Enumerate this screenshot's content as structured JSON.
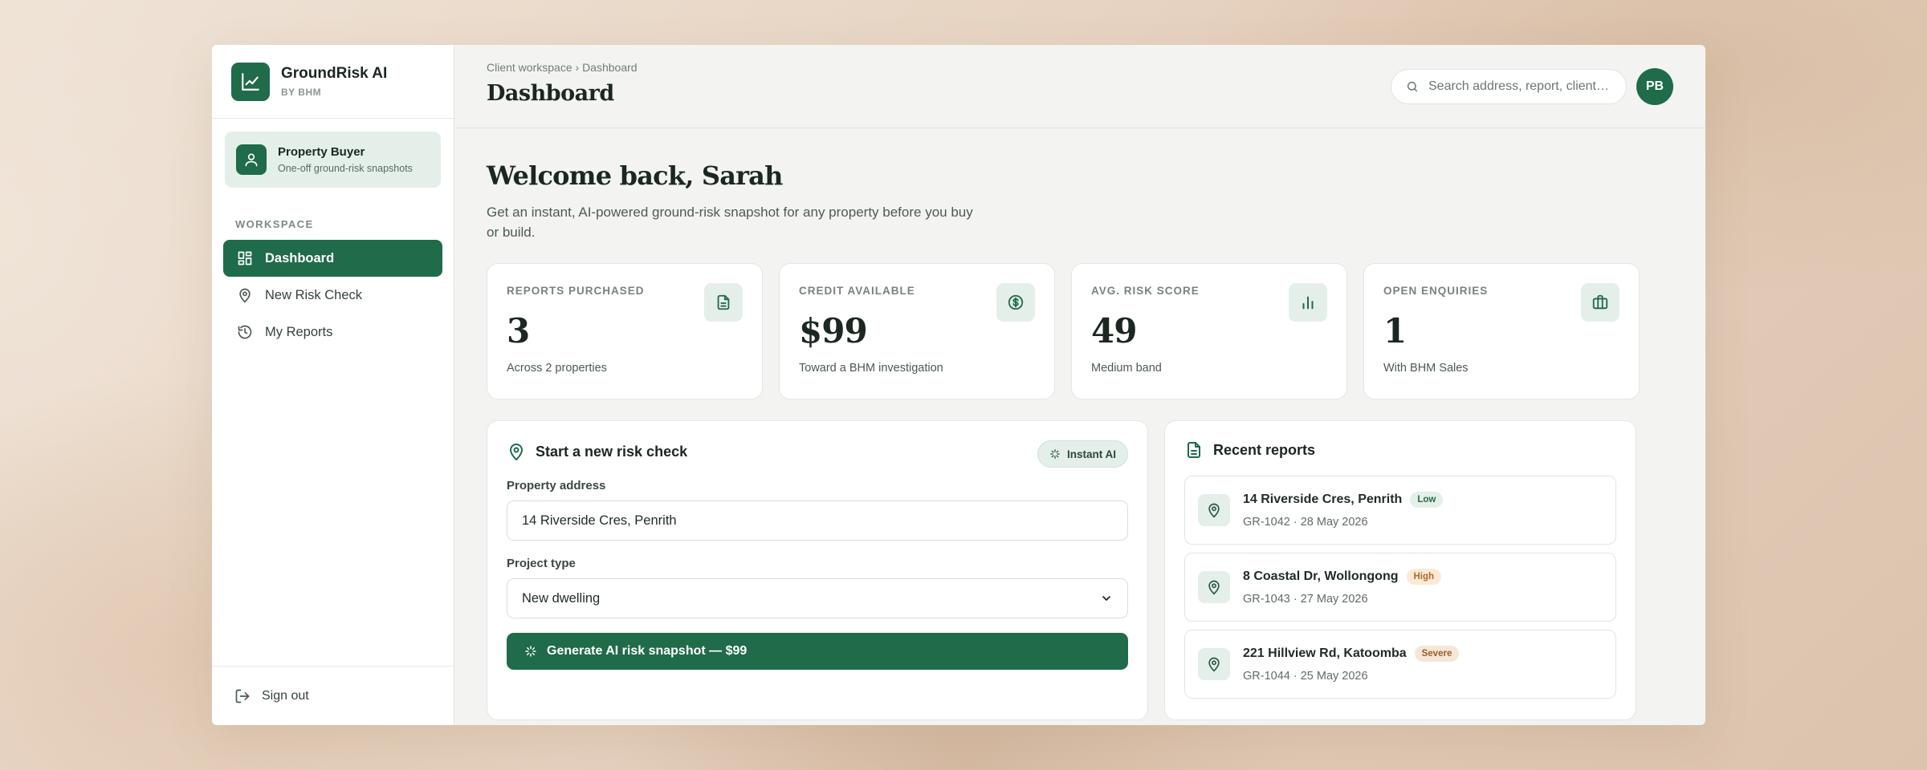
{
  "brand": {
    "name": "GroundRisk AI",
    "sub": "BY BHM"
  },
  "role": {
    "title": "Property Buyer",
    "subtitle": "One-off ground-risk snapshots"
  },
  "sidebar": {
    "section_label": "WORKSPACE",
    "items": [
      {
        "label": "Dashboard",
        "icon": "dashboard-icon",
        "active": true
      },
      {
        "label": "New Risk Check",
        "icon": "map-pin-icon",
        "active": false
      },
      {
        "label": "My Reports",
        "icon": "history-icon",
        "active": false
      }
    ],
    "sign_out": "Sign out"
  },
  "header": {
    "breadcrumb_root": "Client workspace",
    "breadcrumb_sep": "›",
    "breadcrumb_current": "Dashboard",
    "title": "Dashboard",
    "search_placeholder": "Search address, report, client…",
    "avatar_initials": "PB"
  },
  "welcome": {
    "heading": "Welcome back, Sarah",
    "intro": "Get an instant, AI-powered ground-risk snapshot for any property before you buy or build."
  },
  "stats": [
    {
      "label": "REPORTS PURCHASED",
      "value": "3",
      "sub": "Across 2 properties",
      "icon": "document-icon"
    },
    {
      "label": "CREDIT AVAILABLE",
      "value": "$99",
      "sub": "Toward a BHM investigation",
      "icon": "dollar-icon"
    },
    {
      "label": "AVG. RISK SCORE",
      "value": "49",
      "sub": "Medium band",
      "icon": "bar-chart-icon"
    },
    {
      "label": "OPEN ENQUIRIES",
      "value": "1",
      "sub": "With BHM Sales",
      "icon": "briefcase-icon"
    }
  ],
  "risk_check": {
    "title": "Start a new risk check",
    "badge": "Instant AI",
    "address_label": "Property address",
    "address_value": "14 Riverside Cres, Penrith",
    "project_label": "Project type",
    "project_value": "New dwelling",
    "cta": "Generate AI risk snapshot — $99"
  },
  "recent": {
    "title": "Recent reports",
    "items": [
      {
        "address": "14 Riverside Cres, Penrith",
        "risk": "Low",
        "level": "low",
        "meta": "GR-1042 · 28 May 2026"
      },
      {
        "address": "8 Coastal Dr, Wollongong",
        "risk": "High",
        "level": "high",
        "meta": "GR-1043 · 27 May 2026"
      },
      {
        "address": "221 Hillview Rd, Katoomba",
        "risk": "Severe",
        "level": "severe",
        "meta": "GR-1044 · 25 May 2026"
      }
    ]
  },
  "colors": {
    "accent": "#1f6b4a",
    "accent_soft": "#e4efe9",
    "low": "#2b6a47",
    "high": "#b06a25",
    "severe": "#9a5a2a"
  }
}
